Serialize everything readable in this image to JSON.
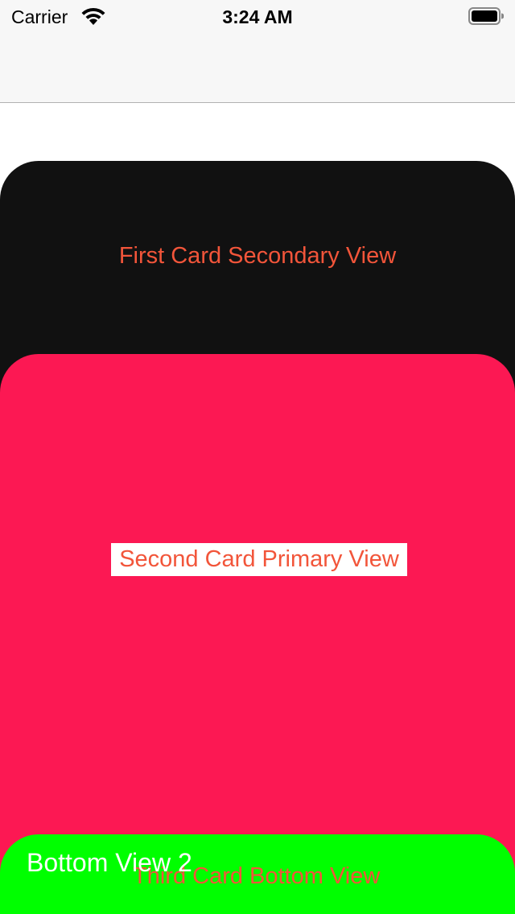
{
  "status_bar": {
    "carrier": "Carrier",
    "time": "3:24 AM",
    "wifi_icon": "wifi-icon",
    "battery_icon": "battery-icon"
  },
  "cards": {
    "first": {
      "label": "First Card Secondary View",
      "background": "#111111"
    },
    "second": {
      "label": "Second Card Primary View",
      "background": "#fc1853"
    },
    "third": {
      "label": "Third Card Bottom View",
      "overlay_label": "Bottom View 2",
      "background": "#00ff00"
    }
  },
  "colors": {
    "label_text": "#f2553a",
    "nav_bar_background": "#f7f7f7"
  }
}
